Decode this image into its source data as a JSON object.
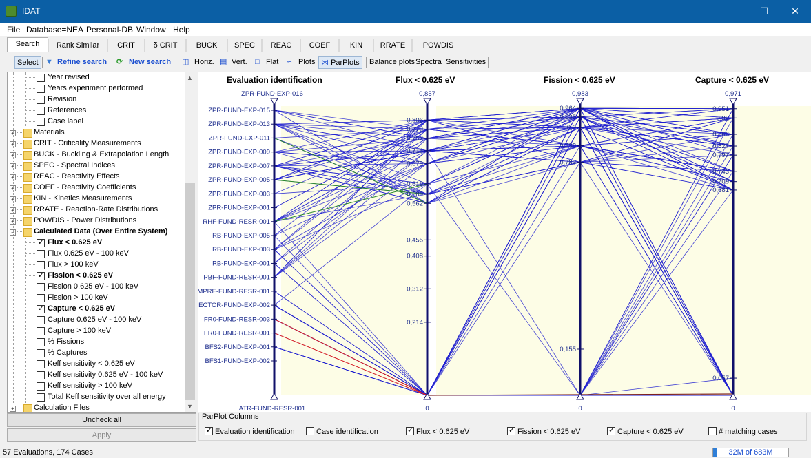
{
  "window": {
    "title": "IDAT",
    "minimize": "—",
    "maximize": "☐",
    "close": "✕"
  },
  "menu": {
    "file": "File",
    "database": "Database=NEA",
    "personal": "Personal-DB",
    "window": "Window",
    "help": "Help"
  },
  "tabs": [
    "Search",
    "Rank Similar",
    "CRIT",
    "δ CRIT",
    "BUCK",
    "SPEC",
    "REAC",
    "COEF",
    "KIN",
    "RRATE",
    "POWDIS"
  ],
  "toolbar": {
    "select": "Select",
    "refine": "Refine search",
    "new_search": "New search",
    "horiz": "Horiz.",
    "vert": "Vert.",
    "flat": "Flat",
    "plots": "Plots",
    "parplots": "ParPlots",
    "balance": "Balance plots",
    "spectra": "Spectra",
    "sensitivities": "Sensitivities"
  },
  "tree": {
    "items": [
      {
        "label": "Year revised",
        "kind": "check",
        "checked": false,
        "level": 2,
        "bold": false
      },
      {
        "label": "Years experiment performed",
        "kind": "check",
        "checked": false,
        "level": 2,
        "bold": false
      },
      {
        "label": "Revision",
        "kind": "check",
        "checked": false,
        "level": 2,
        "bold": false
      },
      {
        "label": "References",
        "kind": "check",
        "checked": false,
        "level": 2,
        "bold": false
      },
      {
        "label": "Case label",
        "kind": "check",
        "checked": false,
        "level": 2,
        "bold": false
      },
      {
        "label": "Materials",
        "kind": "folder",
        "expanded": false,
        "level": 1,
        "bold": false
      },
      {
        "label": "CRIT - Criticality Measurements",
        "kind": "folder",
        "expanded": false,
        "level": 1,
        "bold": false
      },
      {
        "label": "BUCK - Buckling & Extrapolation Length",
        "kind": "folder",
        "expanded": false,
        "level": 1,
        "bold": false
      },
      {
        "label": "SPEC - Spectral Indices",
        "kind": "folder",
        "expanded": false,
        "level": 1,
        "bold": false
      },
      {
        "label": "REAC - Reactivity Effects",
        "kind": "folder",
        "expanded": false,
        "level": 1,
        "bold": false
      },
      {
        "label": "COEF - Reactivity Coefficients",
        "kind": "folder",
        "expanded": false,
        "level": 1,
        "bold": false
      },
      {
        "label": "KIN - Kinetics Measurements",
        "kind": "folder",
        "expanded": false,
        "level": 1,
        "bold": false
      },
      {
        "label": "RRATE - Reaction-Rate Distributions",
        "kind": "folder",
        "expanded": false,
        "level": 1,
        "bold": false
      },
      {
        "label": "POWDIS - Power Distributions",
        "kind": "folder",
        "expanded": false,
        "level": 1,
        "bold": false
      },
      {
        "label": "Calculated Data (Over Entire System)",
        "kind": "folder",
        "expanded": true,
        "level": 1,
        "bold": true
      },
      {
        "label": "Flux < 0.625 eV",
        "kind": "check",
        "checked": true,
        "level": 2,
        "bold": true
      },
      {
        "label": "Flux 0.625 eV - 100 keV",
        "kind": "check",
        "checked": false,
        "level": 2,
        "bold": false
      },
      {
        "label": "Flux > 100 keV",
        "kind": "check",
        "checked": false,
        "level": 2,
        "bold": false
      },
      {
        "label": "Fission < 0.625 eV",
        "kind": "check",
        "checked": true,
        "level": 2,
        "bold": true
      },
      {
        "label": "Fission 0.625 eV - 100 keV",
        "kind": "check",
        "checked": false,
        "level": 2,
        "bold": false
      },
      {
        "label": "Fission > 100 keV",
        "kind": "check",
        "checked": false,
        "level": 2,
        "bold": false
      },
      {
        "label": "Capture < 0.625 eV",
        "kind": "check",
        "checked": true,
        "level": 2,
        "bold": true
      },
      {
        "label": "Capture 0.625 eV - 100 keV",
        "kind": "check",
        "checked": false,
        "level": 2,
        "bold": false
      },
      {
        "label": "Capture > 100 keV",
        "kind": "check",
        "checked": false,
        "level": 2,
        "bold": false
      },
      {
        "label": "% Fissions",
        "kind": "check",
        "checked": false,
        "level": 2,
        "bold": false
      },
      {
        "label": "% Captures",
        "kind": "check",
        "checked": false,
        "level": 2,
        "bold": false
      },
      {
        "label": "Keff sensitivity < 0.625 eV",
        "kind": "check",
        "checked": false,
        "level": 2,
        "bold": false
      },
      {
        "label": "Keff sensitivity 0.625 eV - 100 keV",
        "kind": "check",
        "checked": false,
        "level": 2,
        "bold": false
      },
      {
        "label": "Keff sensitivity > 100 keV",
        "kind": "check",
        "checked": false,
        "level": 2,
        "bold": false
      },
      {
        "label": "Total Keff sensitivity over all energy",
        "kind": "check",
        "checked": false,
        "level": 2,
        "bold": false
      },
      {
        "label": "Calculation Files",
        "kind": "folder",
        "expanded": false,
        "level": 1,
        "bold": false
      }
    ]
  },
  "buttons": {
    "uncheck_all": "Uncheck all",
    "apply": "Apply"
  },
  "chart_data": {
    "type": "parallel-coordinates",
    "axes": [
      {
        "title": "Evaluation identification",
        "kind": "categorical",
        "top_label": "ZPR-FUND-EXP-016",
        "bottom_label": "ATR-FUND-RESR-001",
        "tick_labels": [
          "ZPR-FUND-EXP-015",
          "ZPR-FUND-EXP-013",
          "ZPR-FUND-EXP-011",
          "ZPR-FUND-EXP-009",
          "ZPR-FUND-EXP-007",
          "ZPR-FUND-EXP-005",
          "ZPR-FUND-EXP-003",
          "ZPR-FUND-EXP-001",
          "RHF-FUND-RESR-001",
          "RB-FUND-EXP-005",
          "RB-FUND-EXP-003",
          "RB-FUND-EXP-001",
          "PBF-FUND-RESR-001",
          "MPRE-FUND-RESR-001",
          "ECTOR-FUND-EXP-002",
          "FR0-FUND-RESR-003",
          "FR0-FUND-RESR-001",
          "BFS2-FUND-EXP-001",
          "BFS1-FUND-EXP-002"
        ]
      },
      {
        "title": "Flux < 0.625 eV",
        "kind": "numeric",
        "max": 0.857,
        "min": 0,
        "tick_labels": [
          "0,806",
          "0,779",
          "0,752",
          "0,716",
          "0,679",
          "0,619",
          "0,589",
          "0,562",
          "0,455",
          "0,408",
          "0,312",
          "0,214"
        ],
        "max_label": "0,857",
        "min_label": "0"
      },
      {
        "title": "Fission < 0.625 eV",
        "kind": "numeric",
        "max": 0.983,
        "min": 0,
        "tick_labels": [
          "0,964",
          "0,935",
          "0,9",
          "0,838",
          "0,783",
          "0,155"
        ],
        "max_label": "0,983",
        "min_label": "0"
      },
      {
        "title": "Capture < 0.625 eV",
        "kind": "numeric",
        "max": 0.971,
        "min": 0,
        "tick_labels": [
          "0,951",
          "0,92",
          "0,866",
          "0,827",
          "0,797",
          "0,743",
          "0,709",
          "0,681",
          "0,057"
        ],
        "max_label": "0,971",
        "min_label": "0"
      }
    ],
    "line_color": "#1f1fd0",
    "highlight_colors": [
      "#2a8a2a",
      "#e02020",
      "#7a2020"
    ]
  },
  "parplot_columns": {
    "legend": "ParPlot Columns",
    "options": [
      {
        "label": "Evaluation identification",
        "checked": true
      },
      {
        "label": "Case identification",
        "checked": false
      },
      {
        "label": "Flux < 0.625 eV",
        "checked": true
      },
      {
        "label": "Fission < 0.625 eV",
        "checked": true
      },
      {
        "label": "Capture < 0.625 eV",
        "checked": true
      },
      {
        "label": "# matching cases",
        "checked": false
      }
    ]
  },
  "status": {
    "text": "57 Evaluations, 174 Cases",
    "memory": "32M of 683M",
    "memory_fraction": 0.047
  }
}
